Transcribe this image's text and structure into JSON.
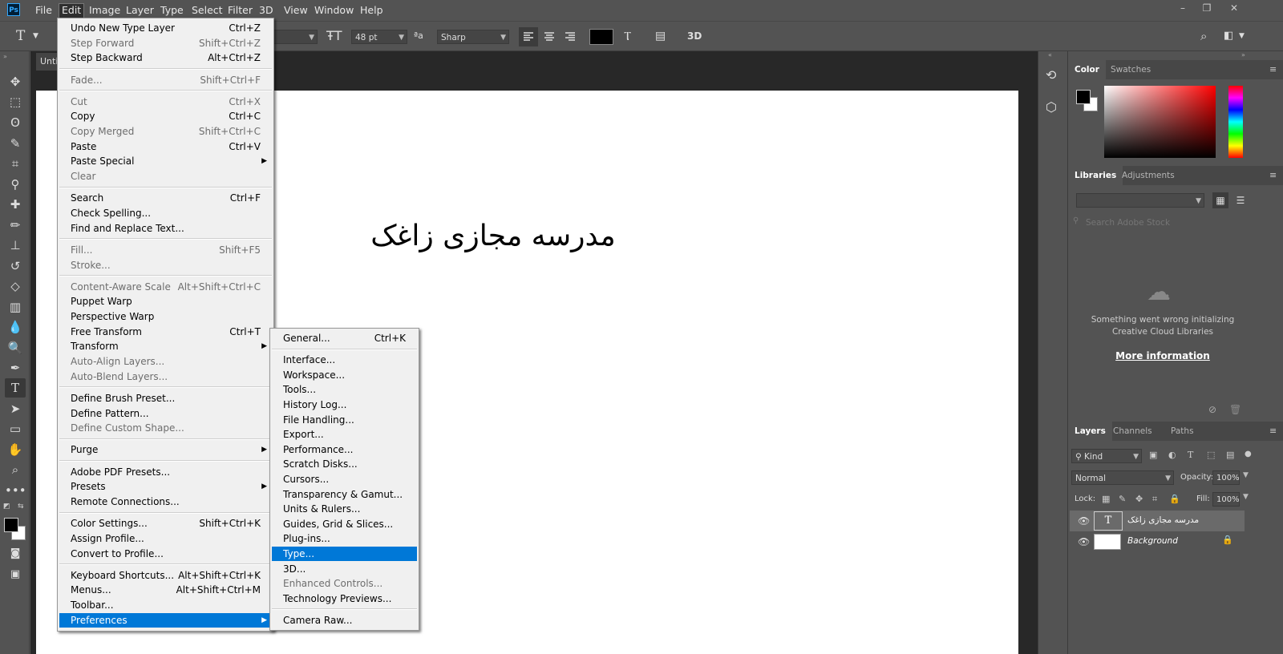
{
  "app": {
    "logo": "Ps"
  },
  "menubar": {
    "items": [
      "File",
      "Edit",
      "Image",
      "Layer",
      "Type",
      "Select",
      "Filter",
      "3D",
      "View",
      "Window",
      "Help"
    ],
    "window_controls": [
      "–",
      "❐",
      "✕"
    ]
  },
  "options_bar": {
    "tool_glyph": "T",
    "font_size": "48 pt",
    "antialias": "Sharp",
    "aa_label": "ªa",
    "threed": "3D"
  },
  "document": {
    "tab_title": "Unti",
    "canvas_text": "مدرسه مجازی زاغک"
  },
  "edit_menu": {
    "items": [
      {
        "label": "Undo New Type Layer",
        "shortcut": "Ctrl+Z",
        "disabled": false
      },
      {
        "label": "Step Forward",
        "shortcut": "Shift+Ctrl+Z",
        "disabled": true
      },
      {
        "label": "Step Backward",
        "shortcut": "Alt+Ctrl+Z",
        "disabled": false
      },
      {
        "sep": true
      },
      {
        "label": "Fade...",
        "shortcut": "Shift+Ctrl+F",
        "disabled": true
      },
      {
        "sep": true
      },
      {
        "label": "Cut",
        "shortcut": "Ctrl+X",
        "disabled": true
      },
      {
        "label": "Copy",
        "shortcut": "Ctrl+C",
        "disabled": false
      },
      {
        "label": "Copy Merged",
        "shortcut": "Shift+Ctrl+C",
        "disabled": true
      },
      {
        "label": "Paste",
        "shortcut": "Ctrl+V",
        "disabled": false
      },
      {
        "label": "Paste Special",
        "shortcut": "",
        "disabled": false,
        "submenu": true
      },
      {
        "label": "Clear",
        "shortcut": "",
        "disabled": true
      },
      {
        "sep": true
      },
      {
        "label": "Search",
        "shortcut": "Ctrl+F",
        "disabled": false
      },
      {
        "label": "Check Spelling...",
        "shortcut": "",
        "disabled": false
      },
      {
        "label": "Find and Replace Text...",
        "shortcut": "",
        "disabled": false
      },
      {
        "sep": true
      },
      {
        "label": "Fill...",
        "shortcut": "Shift+F5",
        "disabled": true
      },
      {
        "label": "Stroke...",
        "shortcut": "",
        "disabled": true
      },
      {
        "sep": true
      },
      {
        "label": "Content-Aware Scale",
        "shortcut": "Alt+Shift+Ctrl+C",
        "disabled": true
      },
      {
        "label": "Puppet Warp",
        "shortcut": "",
        "disabled": false
      },
      {
        "label": "Perspective Warp",
        "shortcut": "",
        "disabled": false
      },
      {
        "label": "Free Transform",
        "shortcut": "Ctrl+T",
        "disabled": false
      },
      {
        "label": "Transform",
        "shortcut": "",
        "disabled": false,
        "submenu": true
      },
      {
        "label": "Auto-Align Layers...",
        "shortcut": "",
        "disabled": true
      },
      {
        "label": "Auto-Blend Layers...",
        "shortcut": "",
        "disabled": true
      },
      {
        "sep": true
      },
      {
        "label": "Define Brush Preset...",
        "shortcut": "",
        "disabled": false
      },
      {
        "label": "Define Pattern...",
        "shortcut": "",
        "disabled": false
      },
      {
        "label": "Define Custom Shape...",
        "shortcut": "",
        "disabled": true
      },
      {
        "sep": true
      },
      {
        "label": "Purge",
        "shortcut": "",
        "disabled": false,
        "submenu": true
      },
      {
        "sep": true
      },
      {
        "label": "Adobe PDF Presets...",
        "shortcut": "",
        "disabled": false
      },
      {
        "label": "Presets",
        "shortcut": "",
        "disabled": false,
        "submenu": true
      },
      {
        "label": "Remote Connections...",
        "shortcut": "",
        "disabled": false
      },
      {
        "sep": true
      },
      {
        "label": "Color Settings...",
        "shortcut": "Shift+Ctrl+K",
        "disabled": false
      },
      {
        "label": "Assign Profile...",
        "shortcut": "",
        "disabled": false
      },
      {
        "label": "Convert to Profile...",
        "shortcut": "",
        "disabled": false
      },
      {
        "sep": true
      },
      {
        "label": "Keyboard Shortcuts...",
        "shortcut": "Alt+Shift+Ctrl+K",
        "disabled": false
      },
      {
        "label": "Menus...",
        "shortcut": "Alt+Shift+Ctrl+M",
        "disabled": false
      },
      {
        "label": "Toolbar...",
        "shortcut": "",
        "disabled": false
      },
      {
        "label": "Preferences",
        "shortcut": "",
        "disabled": false,
        "submenu": true,
        "highlight": true
      }
    ]
  },
  "prefs_menu": {
    "items": [
      {
        "label": "General...",
        "shortcut": "Ctrl+K",
        "disabled": false
      },
      {
        "sep": true
      },
      {
        "label": "Interface...",
        "disabled": false
      },
      {
        "label": "Workspace...",
        "disabled": false
      },
      {
        "label": "Tools...",
        "disabled": false
      },
      {
        "label": "History Log...",
        "disabled": false
      },
      {
        "label": "File Handling...",
        "disabled": false
      },
      {
        "label": "Export...",
        "disabled": false
      },
      {
        "label": "Performance...",
        "disabled": false
      },
      {
        "label": "Scratch Disks...",
        "disabled": false
      },
      {
        "label": "Cursors...",
        "disabled": false
      },
      {
        "label": "Transparency & Gamut...",
        "disabled": false
      },
      {
        "label": "Units & Rulers...",
        "disabled": false
      },
      {
        "label": "Guides, Grid & Slices...",
        "disabled": false
      },
      {
        "label": "Plug-ins...",
        "disabled": false
      },
      {
        "label": "Type...",
        "disabled": false,
        "highlight": true
      },
      {
        "label": "3D...",
        "disabled": false
      },
      {
        "label": "Enhanced Controls...",
        "disabled": true
      },
      {
        "label": "Technology Previews...",
        "disabled": false
      },
      {
        "sep": true
      },
      {
        "label": "Camera Raw...",
        "disabled": false
      }
    ]
  },
  "color_panel": {
    "tabs": [
      "Color",
      "Swatches"
    ]
  },
  "libraries_panel": {
    "tabs": [
      "Libraries",
      "Adjustments"
    ],
    "search_placeholder": "Search Adobe Stock",
    "error_line1": "Something went wrong initializing",
    "error_line2": "Creative Cloud Libraries",
    "more_info": "More information"
  },
  "layers_panel": {
    "tabs": [
      "Layers",
      "Channels",
      "Paths"
    ],
    "kind_label": "Kind",
    "blend_mode": "Normal",
    "opacity_label": "Opacity:",
    "opacity_value": "100%",
    "lock_label": "Lock:",
    "fill_label": "Fill:",
    "fill_value": "100%",
    "layers": [
      {
        "name": "مدرسه مجازی زاغک",
        "type": "text"
      },
      {
        "name": "Background",
        "type": "background"
      }
    ]
  },
  "colors": {
    "highlight": "#0078d7",
    "foreground": "#000000",
    "background": "#ffffff"
  }
}
